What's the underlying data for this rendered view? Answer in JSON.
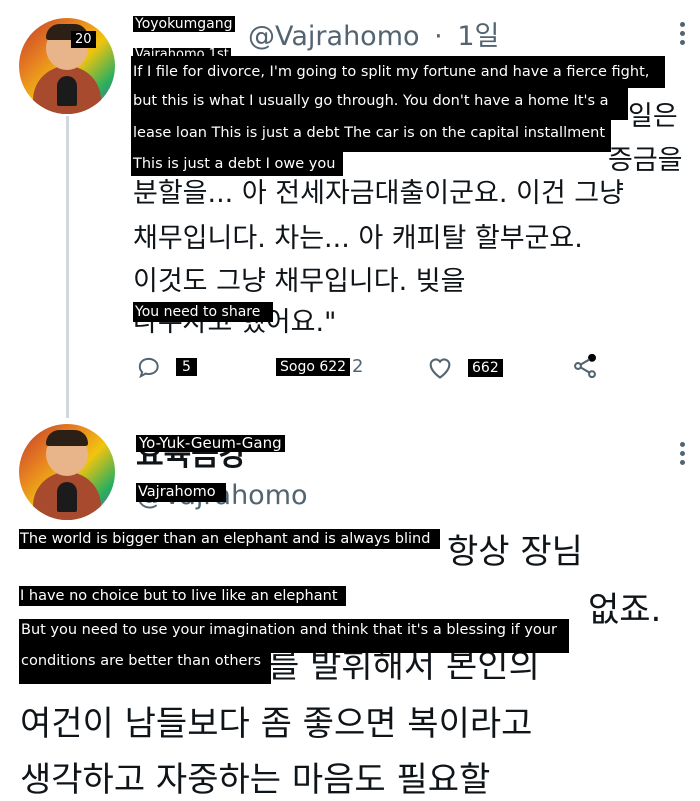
{
  "tweet1": {
    "name_overlay": "Yoyokumgang",
    "badge_overlay": "20",
    "handle": "@Vajrahomo",
    "time_sep": "·",
    "time": "1일",
    "handle_overlay": "Vajrahomo 1st",
    "overlay_lines": [
      "If I file for divorce, I'm going to split my fortune and have a fierce fight,",
      "but this is what I usually go through. You don't have a home It's a",
      "lease loan This is just a debt The car is on the capital installment",
      "This is just a debt I owe you"
    ],
    "korean_right_1": "일은",
    "korean_right_2": "증금을",
    "korean_lines": [
      "분할을... 아 전세자금대출이군요. 이건 그냥",
      "채무입니다. 차는... 아 캐피탈 할부군요.",
      "이것도 그냥 채무입니다. 빚을",
      "나누자고 했어요.\""
    ],
    "share_overlay": "You need to share",
    "actions": {
      "reply_count": "5",
      "retweet_overlay": "Sogo 622",
      "like_count": "662"
    }
  },
  "tweet2": {
    "name_overlay": "Yo-Yuk-Geum-Gang",
    "name_korean": "요육금강",
    "handle_overlay": "Vajrahomo",
    "handle": "@Vajrahomo",
    "overlay_lines": [
      "The world is bigger than an elephant and is always blind",
      "I have no choice but to live like an elephant",
      "But you need to use your imagination and think that it's a blessing if your",
      "conditions are better than others"
    ],
    "korean_line1_tail": "항상 장님",
    "korean_line2_tail": "없죠.",
    "korean_line3_tail": "를 발휘해서 본인의",
    "korean_lines": [
      "여건이 남들보다 좀 좋으면 복이라고",
      "생각하고 자중하는 마음도 필요할"
    ]
  },
  "colors": {
    "text": "#0f1419",
    "muted": "#536471",
    "thread_line": "#cfd9de",
    "overlay_bg": "#000000",
    "overlay_text": "#ffffff"
  },
  "icons": [
    "reply-icon",
    "retweet-icon",
    "like-icon",
    "share-icon",
    "more-icon"
  ]
}
